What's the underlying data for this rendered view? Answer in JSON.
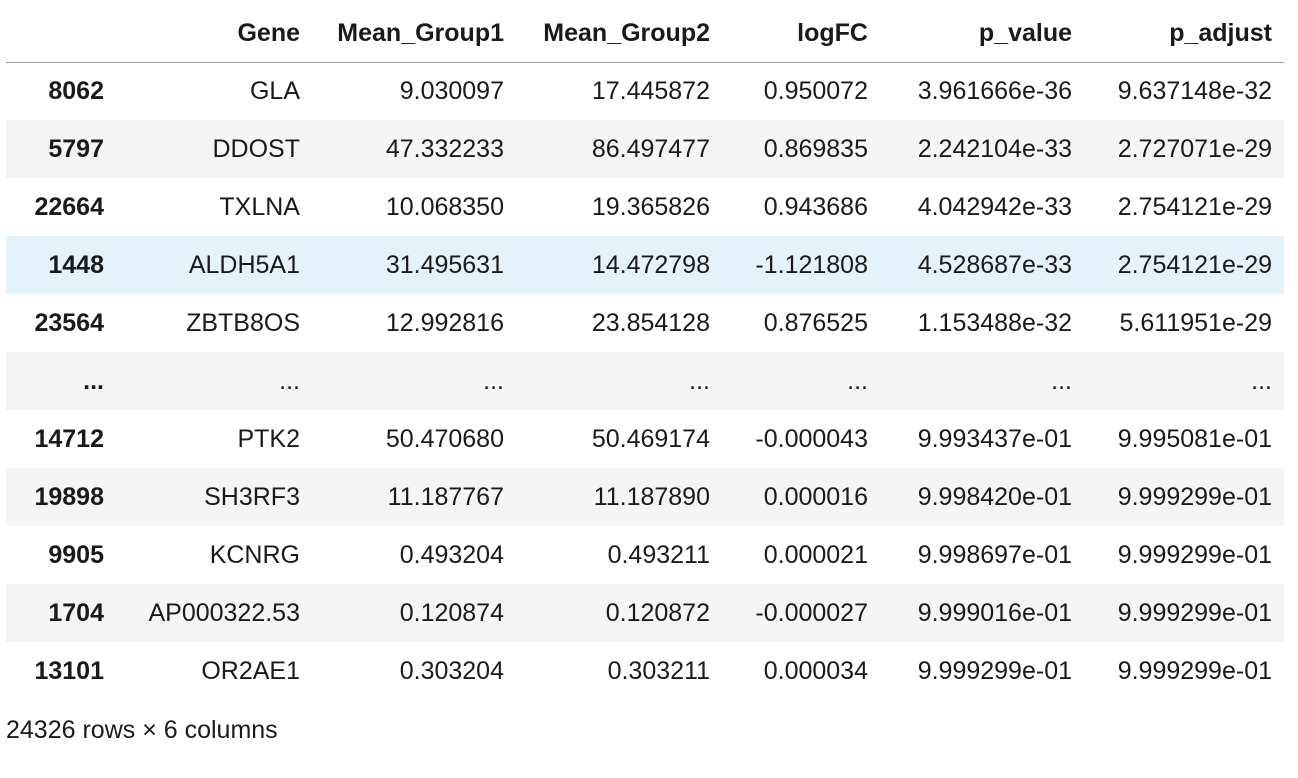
{
  "table": {
    "columns": [
      "",
      "Gene",
      "Mean_Group1",
      "Mean_Group2",
      "logFC",
      "p_value",
      "p_adjust"
    ],
    "rows": [
      {
        "index": "8062",
        "cells": [
          "GLA",
          "9.030097",
          "17.445872",
          "0.950072",
          "3.961666e-36",
          "9.637148e-32"
        ]
      },
      {
        "index": "5797",
        "cells": [
          "DDOST",
          "47.332233",
          "86.497477",
          "0.869835",
          "2.242104e-33",
          "2.727071e-29"
        ]
      },
      {
        "index": "22664",
        "cells": [
          "TXLNA",
          "10.068350",
          "19.365826",
          "0.943686",
          "4.042942e-33",
          "2.754121e-29"
        ]
      },
      {
        "index": "1448",
        "cells": [
          "ALDH5A1",
          "31.495631",
          "14.472798",
          "-1.121808",
          "4.528687e-33",
          "2.754121e-29"
        ]
      },
      {
        "index": "23564",
        "cells": [
          "ZBTB8OS",
          "12.992816",
          "23.854128",
          "0.876525",
          "1.153488e-32",
          "5.611951e-29"
        ]
      },
      {
        "index": "...",
        "cells": [
          "...",
          "...",
          "...",
          "...",
          "...",
          "..."
        ]
      },
      {
        "index": "14712",
        "cells": [
          "PTK2",
          "50.470680",
          "50.469174",
          "-0.000043",
          "9.993437e-01",
          "9.995081e-01"
        ]
      },
      {
        "index": "19898",
        "cells": [
          "SH3RF3",
          "11.187767",
          "11.187890",
          "0.000016",
          "9.998420e-01",
          "9.999299e-01"
        ]
      },
      {
        "index": "9905",
        "cells": [
          "KCNRG",
          "0.493204",
          "0.493211",
          "0.000021",
          "9.998697e-01",
          "9.999299e-01"
        ]
      },
      {
        "index": "1704",
        "cells": [
          "AP000322.53",
          "0.120874",
          "0.120872",
          "-0.000027",
          "9.999016e-01",
          "9.999299e-01"
        ]
      },
      {
        "index": "13101",
        "cells": [
          "OR2AE1",
          "0.303204",
          "0.303211",
          "0.000034",
          "9.999299e-01",
          "9.999299e-01"
        ]
      }
    ],
    "hover_row": 3
  },
  "footer": {
    "shape_text": "24326 rows × 6 columns"
  },
  "colors": {
    "row_stripe": "#f5f5f5",
    "row_hover": "#e3f2fb",
    "header_border": "#9a9a9a"
  }
}
